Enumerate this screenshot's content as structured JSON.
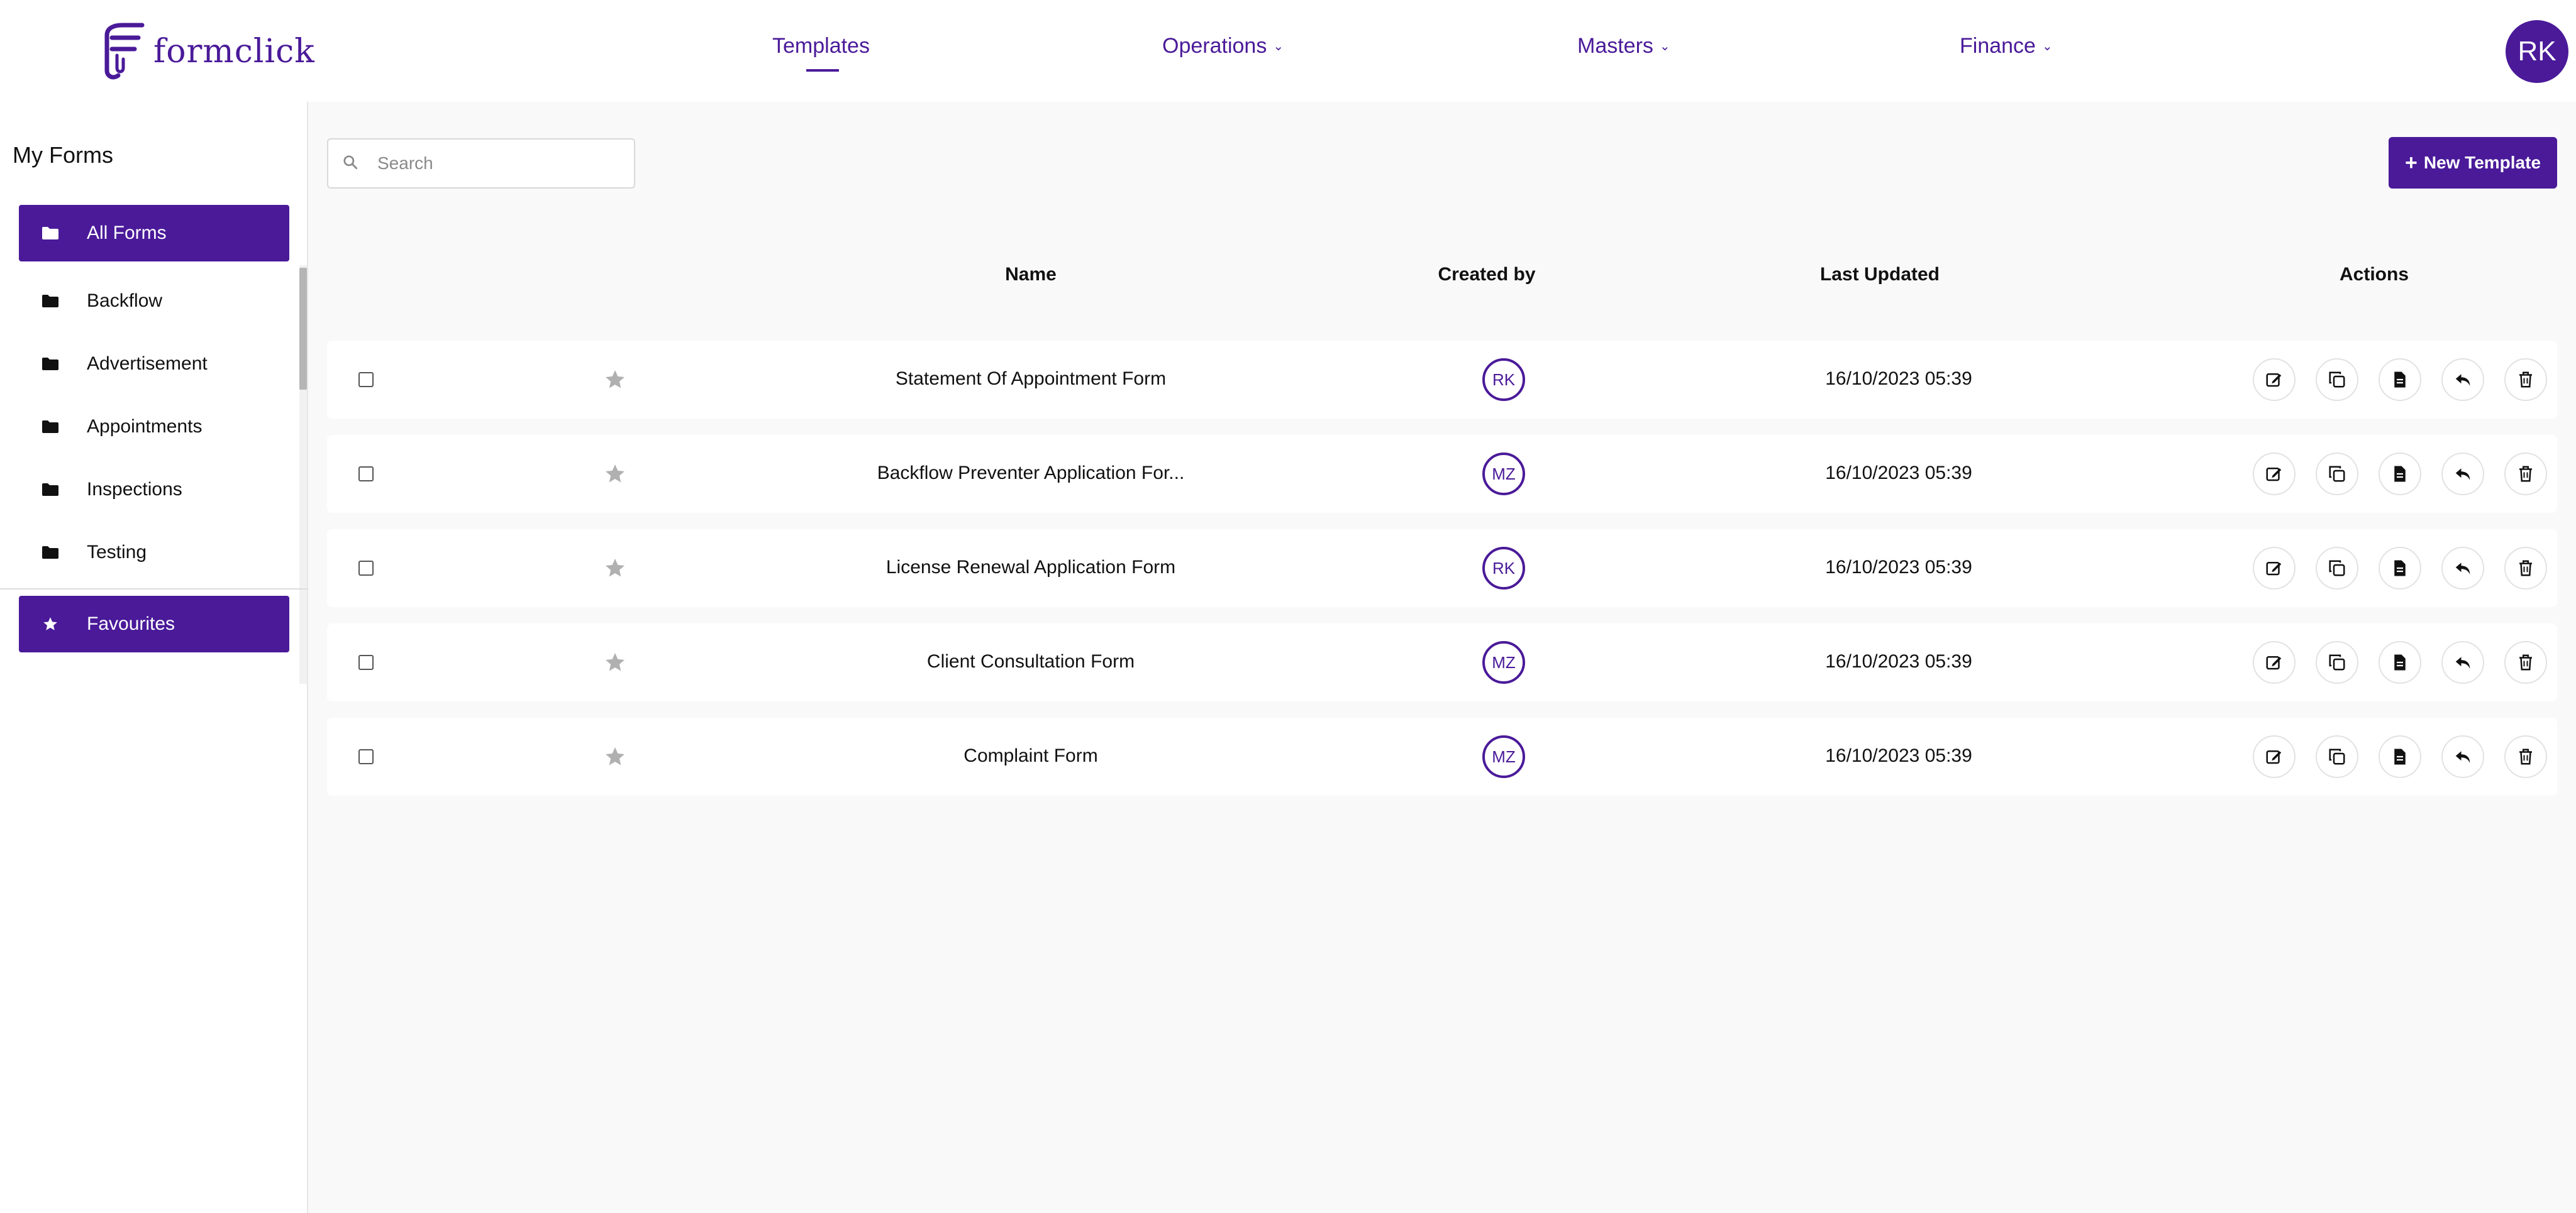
{
  "app": {
    "logo_text": "formclick"
  },
  "nav": {
    "items": [
      {
        "label": "Templates",
        "active": true,
        "has_dropdown": false
      },
      {
        "label": "Operations",
        "has_dropdown": true
      },
      {
        "label": "Masters",
        "has_dropdown": true
      },
      {
        "label": "Finance",
        "has_dropdown": true
      }
    ],
    "user_initials": "RK"
  },
  "sidebar": {
    "title": "My Forms",
    "items": [
      {
        "label": "All Forms",
        "icon": "folder-icon",
        "active": true
      },
      {
        "label": "Backflow",
        "icon": "folder-icon"
      },
      {
        "label": "Advertisement",
        "icon": "folder-icon"
      },
      {
        "label": "Appointments",
        "icon": "folder-icon"
      },
      {
        "label": "Inspections",
        "icon": "folder-icon"
      },
      {
        "label": "Testing",
        "icon": "folder-icon"
      }
    ],
    "favourites": {
      "label": "Favourites",
      "icon": "star-icon",
      "active": true
    }
  },
  "toolbar": {
    "search_placeholder": "Search",
    "new_template_label": "New Template"
  },
  "table": {
    "columns": [
      "Name",
      "Created by",
      "Last Updated",
      "Actions"
    ],
    "rows": [
      {
        "name": "Statement Of Appointment Form",
        "created_by": "RK",
        "last_updated": "16/10/2023 05:39"
      },
      {
        "name": "Backflow Preventer Application For...",
        "created_by": "MZ",
        "last_updated": "16/10/2023 05:39"
      },
      {
        "name": "License Renewal Application Form",
        "created_by": "RK",
        "last_updated": "16/10/2023 05:39"
      },
      {
        "name": "Client Consultation Form",
        "created_by": "MZ",
        "last_updated": "16/10/2023 05:39"
      },
      {
        "name": "Complaint Form",
        "created_by": "MZ",
        "last_updated": "16/10/2023 05:39"
      }
    ],
    "action_icons": [
      "edit-icon",
      "copy-icon",
      "document-icon",
      "reply-icon",
      "trash-icon"
    ]
  },
  "colors": {
    "accent": "#4a1a99",
    "background": "#f9f9f9"
  }
}
